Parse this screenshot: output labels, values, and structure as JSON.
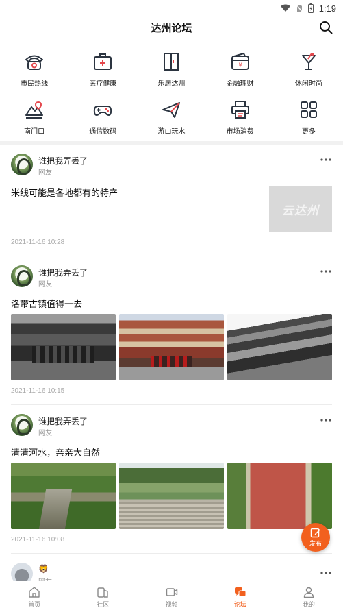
{
  "status_bar": {
    "time": "1:19"
  },
  "header": {
    "title": "达州论坛"
  },
  "categories": [
    {
      "label": "市民热线",
      "icon": "telephone-icon"
    },
    {
      "label": "医疗健康",
      "icon": "medical-kit-icon"
    },
    {
      "label": "乐居达州",
      "icon": "door-icon"
    },
    {
      "label": "金融理财",
      "icon": "wallet-icon"
    },
    {
      "label": "休闲时尚",
      "icon": "cocktail-icon"
    },
    {
      "label": "南门口",
      "icon": "landscape-icon"
    },
    {
      "label": "通信数码",
      "icon": "gamepad-icon"
    },
    {
      "label": "游山玩水",
      "icon": "paper-plane-icon"
    },
    {
      "label": "市场消费",
      "icon": "printer-icon"
    },
    {
      "label": "更多",
      "icon": "grid-icon"
    }
  ],
  "posts": [
    {
      "author": "谁把我弄丢了",
      "role": "网友",
      "text": "米线可能是各地都有的特产",
      "date": "2021-11-16 10:28",
      "thumb_text": "云达州"
    },
    {
      "author": "谁把我弄丢了",
      "role": "网友",
      "text": "洛带古镇值得一去",
      "date": "2021-11-16 10:15"
    },
    {
      "author": "谁把我弄丢了",
      "role": "网友",
      "text": "清清河水，亲亲大自然",
      "date": "2021-11-16 10:08"
    },
    {
      "author": "🦁",
      "role": "网友"
    }
  ],
  "fab": {
    "label": "发布"
  },
  "bottom_nav": [
    {
      "label": "首页",
      "icon": "home-icon",
      "active": false
    },
    {
      "label": "社区",
      "icon": "community-icon",
      "active": false
    },
    {
      "label": "视频",
      "icon": "video-icon",
      "active": false
    },
    {
      "label": "论坛",
      "icon": "forum-icon",
      "active": true
    },
    {
      "label": "我的",
      "icon": "profile-icon",
      "active": false
    }
  ],
  "colors": {
    "accent": "#f2601e",
    "icon_dark": "#2b3440",
    "icon_red": "#e5484d"
  }
}
